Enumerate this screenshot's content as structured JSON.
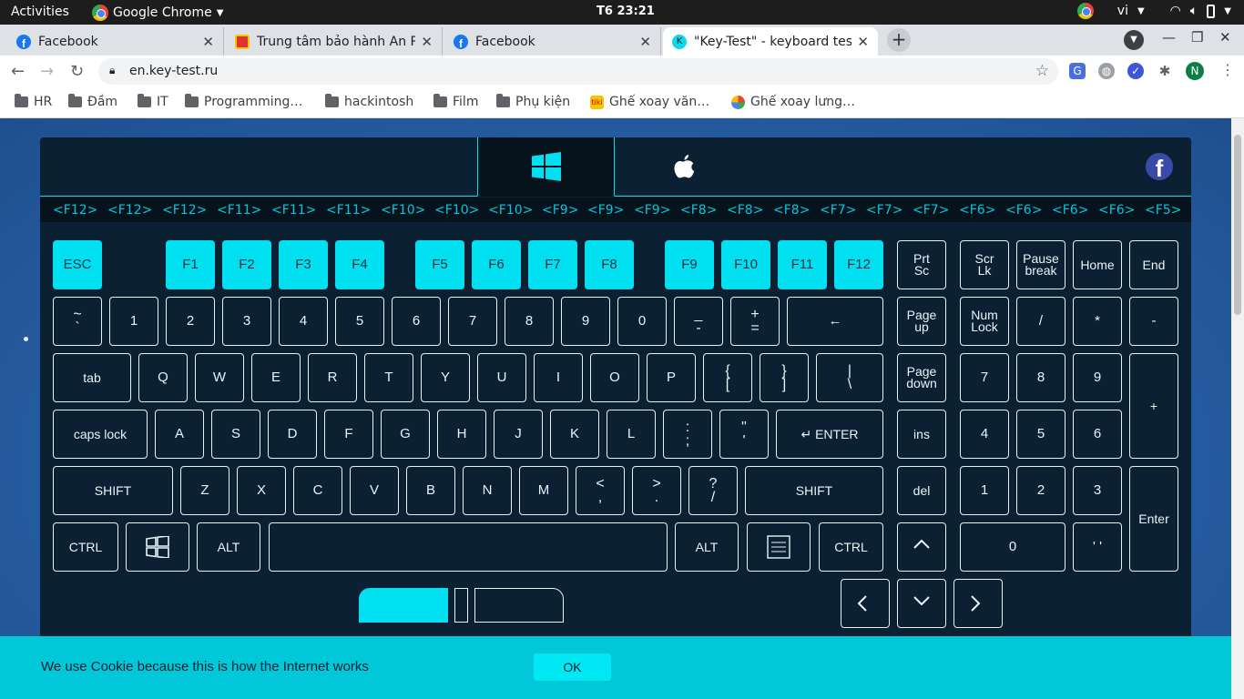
{
  "system_bar": {
    "activities": "Activities",
    "app_name": "Google Chrome",
    "clock": "T6 23:21",
    "language": "vi"
  },
  "tabs": [
    {
      "title": "Facebook",
      "icon": "facebook-icon",
      "active": false
    },
    {
      "title": "Trung tâm bảo hành An Phát",
      "icon": "site-icon",
      "active": false
    },
    {
      "title": "Facebook",
      "icon": "facebook-icon",
      "active": false
    },
    {
      "title": "\"Key-Test\" - keyboard test",
      "icon": "keytest-icon",
      "active": true
    }
  ],
  "toolbar": {
    "url": "en.key-test.ru",
    "profile_initial": "N"
  },
  "bookmarks": [
    "HR",
    "Đầm",
    "IT",
    "Programming…",
    "hackintosh",
    "Film",
    "Phụ kiện",
    "Ghế xoay văn…",
    "Ghế xoay lưng…"
  ],
  "key_history": [
    "<F12>",
    "<F12>",
    "<F12>",
    "<F11>",
    "<F11>",
    "<F11>",
    "<F10>",
    "<F10>",
    "<F10>",
    "<F9>",
    "<F9>",
    "<F9>",
    "<F8>",
    "<F8>",
    "<F8>",
    "<F7>",
    "<F7>",
    "<F7>",
    "<F6>",
    "<F6>",
    "<F6>",
    "<F6>",
    "<F5>"
  ],
  "keys": {
    "esc": "ESC",
    "f1": "F1",
    "f2": "F2",
    "f3": "F3",
    "f4": "F4",
    "f5": "F5",
    "f6": "F6",
    "f7": "F7",
    "f8": "F8",
    "f9": "F9",
    "f10": "F10",
    "f11": "F11",
    "f12": "F12",
    "prtsc_1": "Prt",
    "prtsc_2": "Sc",
    "scrlk_1": "Scr",
    "scrlk_2": "Lk",
    "pause_1": "Pause",
    "pause_2": "break",
    "home": "Home",
    "end": "End",
    "tilde_top": "~",
    "tilde_bottom": "`",
    "d1": "1",
    "d2": "2",
    "d3": "3",
    "d4": "4",
    "d5": "5",
    "d6": "6",
    "d7": "7",
    "d8": "8",
    "d9": "9",
    "d0": "0",
    "minus_top": "_",
    "minus_bottom": "-",
    "plus_top": "+",
    "plus_bottom": "=",
    "backspace": "←",
    "pageup_1": "Page",
    "pageup_2": "up",
    "numlock_1": "Num",
    "numlock_2": "Lock",
    "num_slash": "/",
    "num_star": "*",
    "num_minus": "-",
    "tab": "tab",
    "q": "Q",
    "w": "W",
    "e": "E",
    "r": "R",
    "t": "T",
    "y": "Y",
    "u": "U",
    "i": "I",
    "o": "O",
    "p": "P",
    "lbrace_top": "{",
    "lbrace_bottom": "[",
    "rbrace_top": "}",
    "rbrace_bottom": "]",
    "pipe_top": "|",
    "pipe_bottom": "\\",
    "pagedown_1": "Page",
    "pagedown_2": "down",
    "n7": "7",
    "n8": "8",
    "n9": "9",
    "num_plus": "+",
    "capslock": "caps lock",
    "a": "A",
    "s": "S",
    "d": "D",
    "f": "F",
    "g": "G",
    "h": "H",
    "j": "J",
    "k": "K",
    "l": "L",
    "colon_top": ":",
    "colon_bottom": ";",
    "quote_top": "\"",
    "quote_bottom": "'",
    "enter": "↵ ENTER",
    "ins": "ins",
    "n4": "4",
    "n5": "5",
    "n6": "6",
    "shift_left": "SHIFT",
    "z": "Z",
    "x": "X",
    "c": "C",
    "v": "V",
    "b": "B",
    "n": "N",
    "m": "M",
    "lt_top": "<",
    "lt_bottom": ",",
    "gt_top": ">",
    "gt_bottom": ".",
    "q_top": "?",
    "q_bottom": "/",
    "shift_right": "SHIFT",
    "del": "del",
    "n1": "1",
    "n2": "2",
    "n3": "3",
    "num_enter": "Enter",
    "ctrl_left": "CTRL",
    "alt_left": "ALT",
    "alt_right": "ALT",
    "ctrl_right": "CTRL",
    "n0": "0",
    "num_dot": "' '"
  },
  "cookie": {
    "text": "We use Cookie because this is how the Internet works",
    "ok": "OK"
  },
  "colors": {
    "accent": "#00e0f0",
    "panel": "#0b2033",
    "cookie_bar": "#00c8d8"
  }
}
